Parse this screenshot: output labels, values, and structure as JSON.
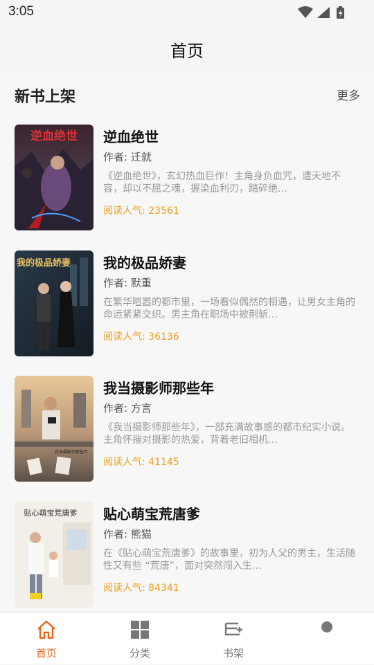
{
  "status_bar": {
    "time": "3:05"
  },
  "app_bar": {
    "title": "首页"
  },
  "section": {
    "title": "新书上架",
    "more": "更多"
  },
  "books": [
    {
      "title": "逆血绝世",
      "author_label": "作者: 迁就",
      "desc": "《逆血绝世》，玄幻热血巨作！主角身负血咒，遭天地不容，却以不屈之魂，握染血利刃，踏碎绝…",
      "popularity_label": "阅读人气: ",
      "popularity": "23561",
      "cover_text": "逆血绝世"
    },
    {
      "title": "我的极品娇妻",
      "author_label": "作者: 默重",
      "desc": "在繁华喧嚣的都市里，一场看似偶然的相遇，让男女主角的命运紧紧交织。男主角在职场中披荆斩…",
      "popularity_label": "阅读人气: ",
      "popularity": "36136",
      "cover_text": "我的极品娇妻"
    },
    {
      "title": "我当摄影师那些年",
      "author_label": "作者: 方言",
      "desc": "《我当摄影师那些年》，一部充满故事感的都市纪实小说。主角怀揣对摄影的热爱，背着老旧相机…",
      "popularity_label": "阅读人气: ",
      "popularity": "41145",
      "cover_text": "我当摄影师那些年"
    },
    {
      "title": "贴心萌宝荒唐爹",
      "author_label": "作者: 熊猫",
      "desc": "在《贴心萌宝荒唐爹》的故事里，初为人父的男主，生活随性又有些 “荒唐”，面对突然闯入生…",
      "popularity_label": "阅读人气: ",
      "popularity": "84341",
      "cover_text": "贴心萌宝荒唐爹"
    }
  ],
  "bottom_nav": [
    {
      "label": "首页",
      "icon": "home-icon",
      "active": true
    },
    {
      "label": "分类",
      "icon": "grid-icon",
      "active": false
    },
    {
      "label": "书架",
      "icon": "bookshelf-icon",
      "active": false
    },
    {
      "label": "",
      "icon": "profile-icon",
      "active": false
    }
  ],
  "colors": {
    "accent": "#e8671c",
    "popularity": "#f0a020",
    "background": "#f7f7f7"
  }
}
